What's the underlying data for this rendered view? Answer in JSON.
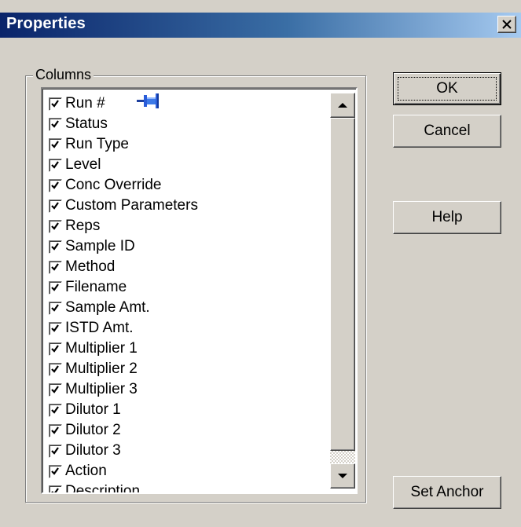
{
  "window": {
    "title": "Properties"
  },
  "columns_group": {
    "label": "Columns",
    "items": [
      {
        "label": "Run #",
        "checked": true
      },
      {
        "label": "Status",
        "checked": true
      },
      {
        "label": "Run Type",
        "checked": true
      },
      {
        "label": "Level",
        "checked": true
      },
      {
        "label": "Conc Override",
        "checked": true
      },
      {
        "label": "Custom Parameters",
        "checked": true
      },
      {
        "label": "Reps",
        "checked": true
      },
      {
        "label": "Sample ID",
        "checked": true
      },
      {
        "label": "Method",
        "checked": true
      },
      {
        "label": "Filename",
        "checked": true
      },
      {
        "label": "Sample Amt.",
        "checked": true
      },
      {
        "label": "ISTD Amt.",
        "checked": true
      },
      {
        "label": "Multiplier 1",
        "checked": true
      },
      {
        "label": "Multiplier 2",
        "checked": true
      },
      {
        "label": "Multiplier 3",
        "checked": true
      },
      {
        "label": "Dilutor 1",
        "checked": true
      },
      {
        "label": "Dilutor 2",
        "checked": true
      },
      {
        "label": "Dilutor 3",
        "checked": true
      },
      {
        "label": "Action",
        "checked": true
      },
      {
        "label": "Description",
        "checked": true
      }
    ]
  },
  "buttons": {
    "ok": "OK",
    "cancel": "Cancel",
    "help": "Help",
    "set_anchor": "Set Anchor"
  },
  "icons": {
    "close": "close-icon",
    "anchor_pin": "pin-icon",
    "scroll_up": "arrow-up-icon",
    "scroll_down": "arrow-down-icon",
    "check": "check-icon"
  },
  "colors": {
    "title_gradient_start": "#0a246a",
    "title_gradient_end": "#a6caf0",
    "dialog_face": "#d4d0c8",
    "pin_blue": "#2a5cd8"
  }
}
